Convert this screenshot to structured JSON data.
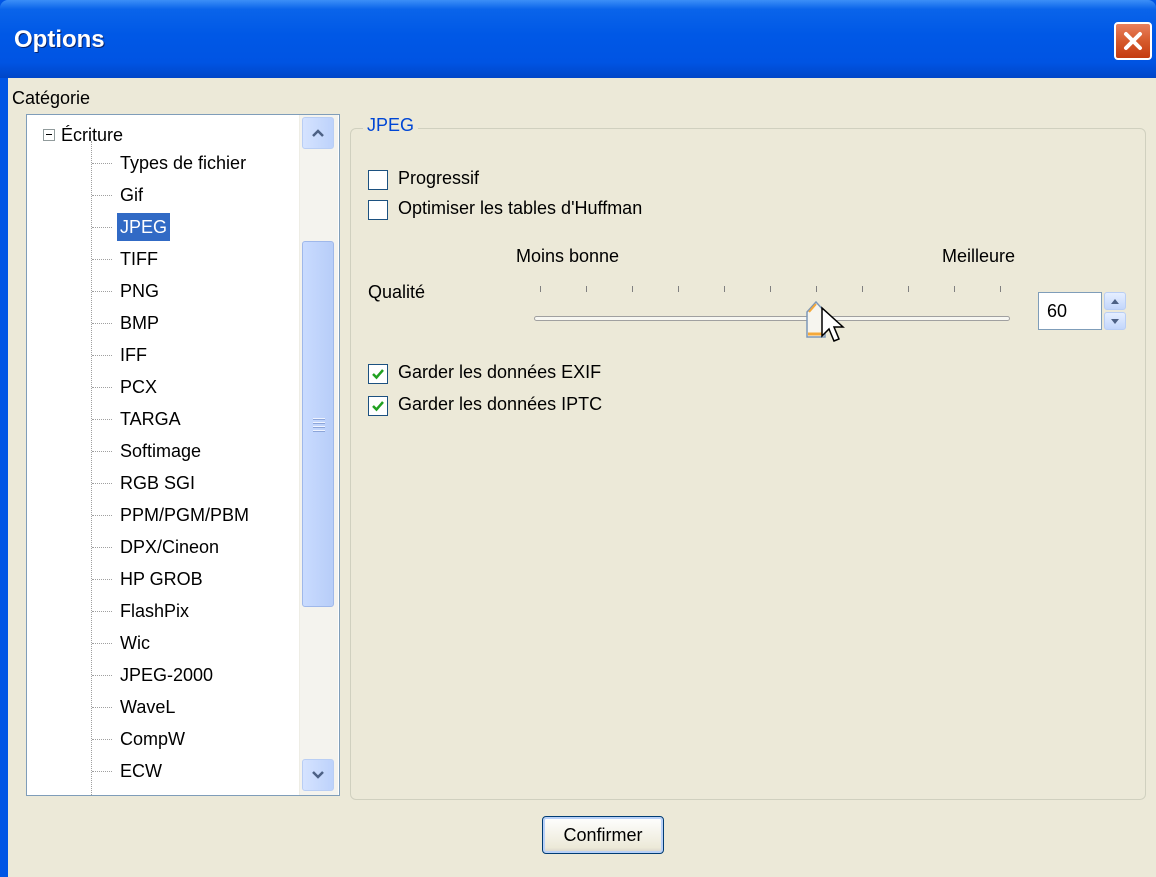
{
  "window": {
    "title": "Options"
  },
  "category_label": "Catégorie",
  "tree": {
    "root": "Écriture",
    "items": [
      "Types de fichier",
      "Gif",
      "JPEG",
      "TIFF",
      "PNG",
      "BMP",
      "IFF",
      "PCX",
      "TARGA",
      "Softimage",
      "RGB SGI",
      "PPM/PGM/PBM",
      "DPX/Cineon",
      "HP GROB",
      "FlashPix",
      "Wic",
      "JPEG-2000",
      "WaveL",
      "CompW",
      "ECW"
    ],
    "selected_index": 2
  },
  "group": {
    "title": "JPEG",
    "progressive": {
      "label": "Progressif",
      "checked": false
    },
    "huffman": {
      "label": "Optimiser les tables d'Huffman",
      "checked": false
    },
    "quality": {
      "label": "Qualité",
      "low_label": "Moins bonne",
      "high_label": "Meilleure",
      "value": "60",
      "slider_fraction": 0.6
    },
    "exif": {
      "label": "Garder les données EXIF",
      "checked": true
    },
    "iptc": {
      "label": "Garder les données IPTC",
      "checked": true
    }
  },
  "confirm_label": "Confirmer",
  "icons": {
    "close": "close-icon",
    "expander": "minus-expander-icon",
    "checkmark": "checkmark-icon"
  },
  "colors": {
    "titlebar": "#0054e3",
    "selection": "#316ac5",
    "group_title": "#0046d5"
  }
}
